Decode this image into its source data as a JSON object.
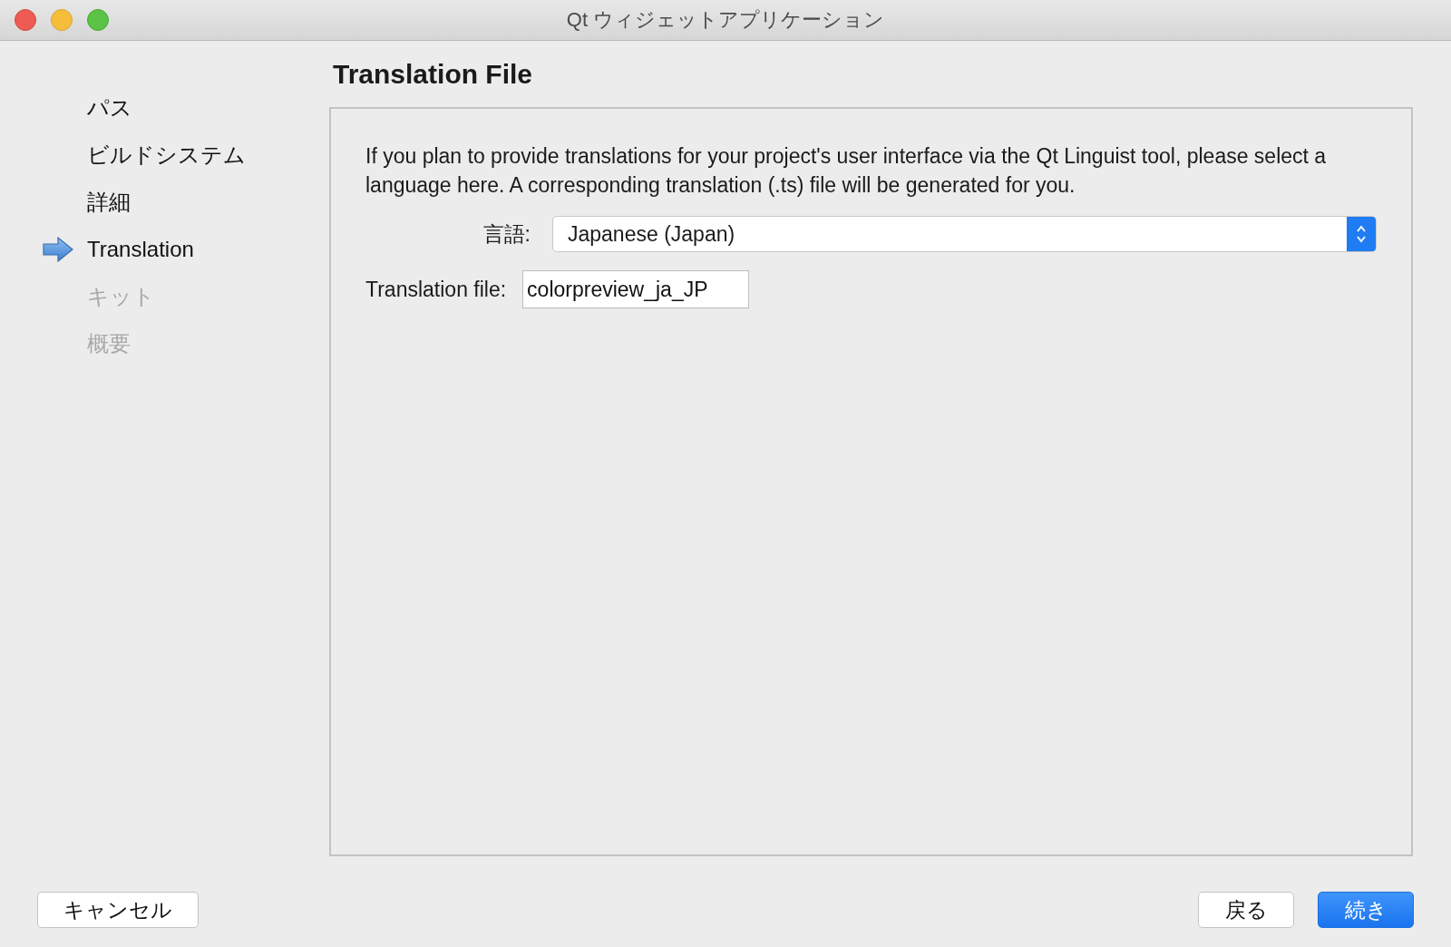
{
  "window": {
    "title": "Qt ウィジェットアプリケーション"
  },
  "sidebar": {
    "items": [
      {
        "label": "パス",
        "current": false,
        "disabled": false
      },
      {
        "label": "ビルドシステム",
        "current": false,
        "disabled": false
      },
      {
        "label": "詳細",
        "current": false,
        "disabled": false
      },
      {
        "label": "Translation",
        "current": true,
        "disabled": false
      },
      {
        "label": "キット",
        "current": false,
        "disabled": true
      },
      {
        "label": "概要",
        "current": false,
        "disabled": true
      }
    ]
  },
  "page": {
    "title": "Translation File",
    "description": "If you plan to provide translations for your project's user interface via the Qt Linguist tool, please select a language here. A corresponding translation (.ts) file will be generated for you.",
    "language": {
      "label": "言語:",
      "value": "Japanese (Japan)"
    },
    "translation_file": {
      "label": "Translation file:",
      "value": "colorpreview_ja_JP"
    }
  },
  "buttons": {
    "cancel": "キャンセル",
    "back": "戻る",
    "next": "続き"
  }
}
